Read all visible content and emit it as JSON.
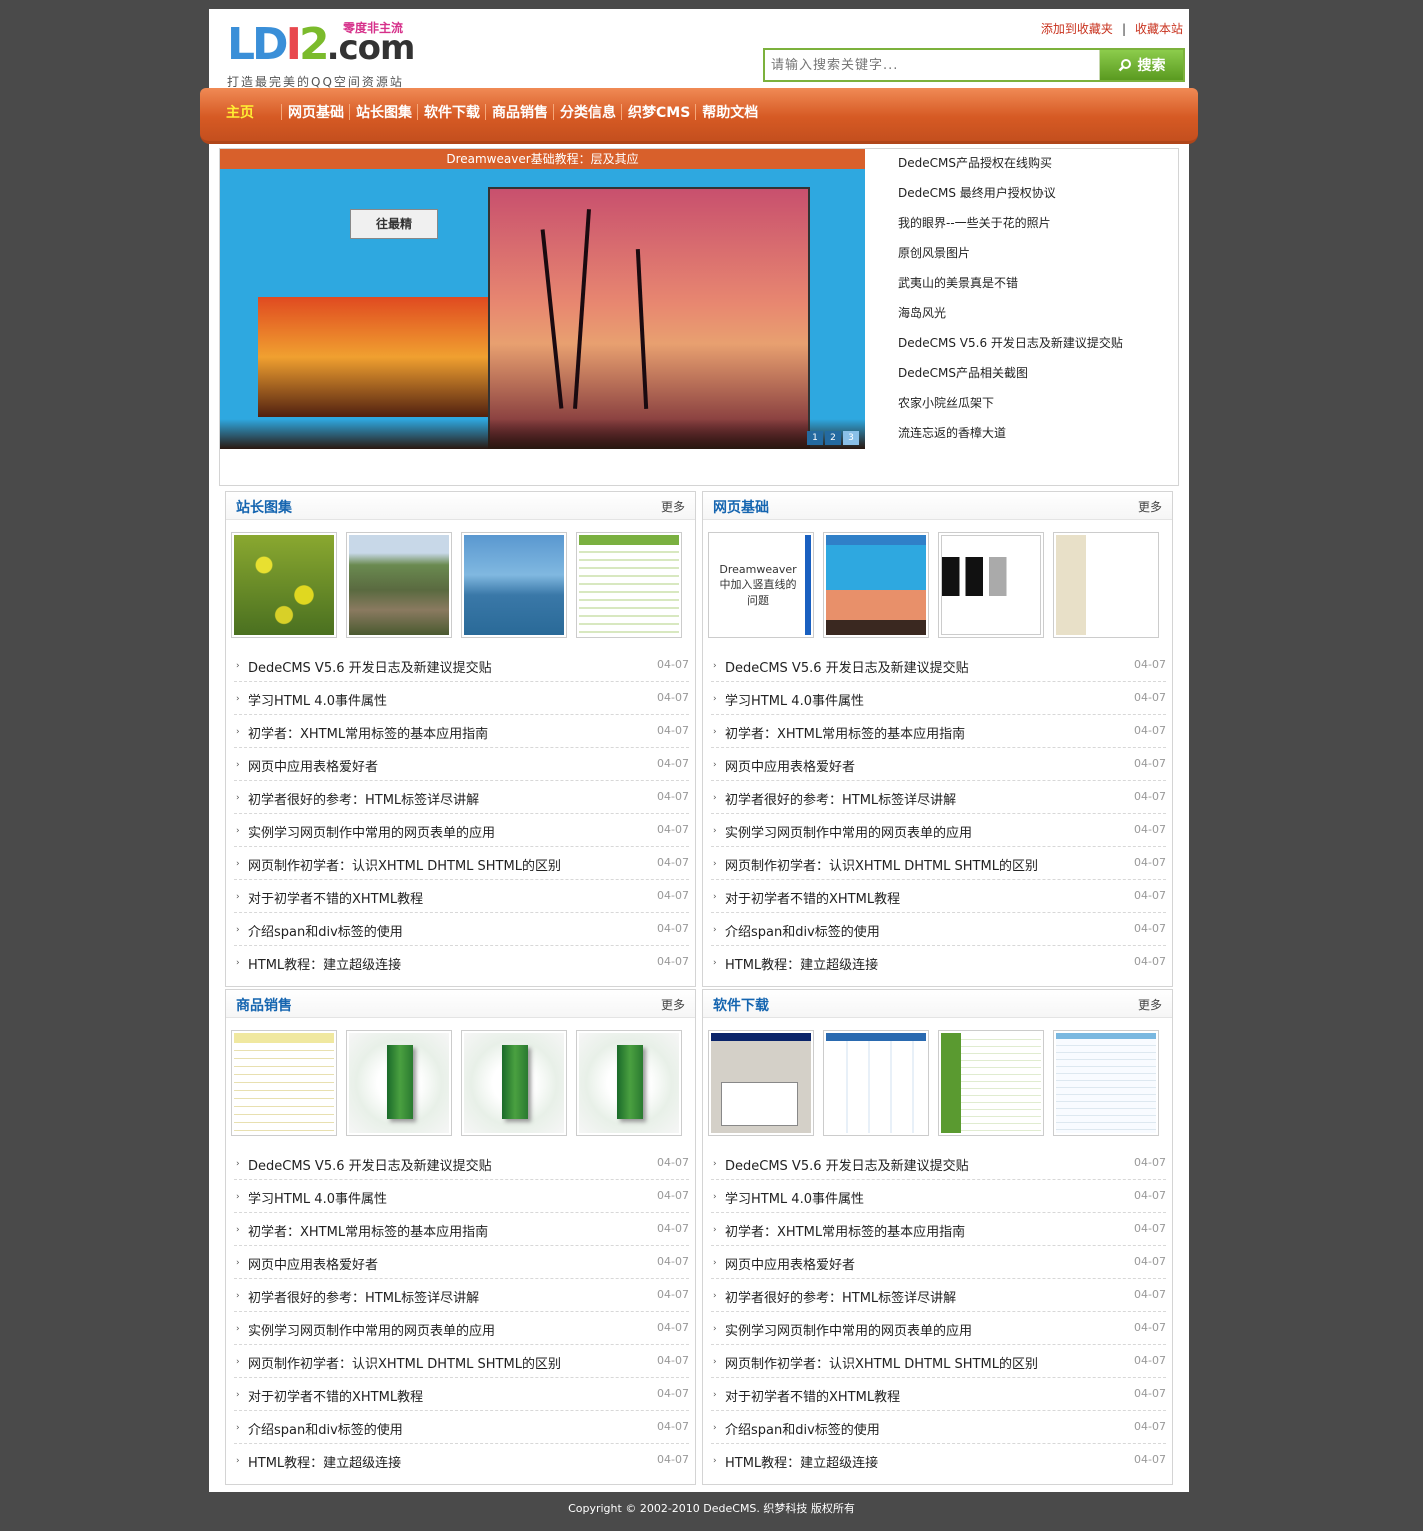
{
  "header": {
    "logo": {
      "part1": "LD",
      "part2": "I",
      "part3": "2",
      "part4": ".com",
      "tagline": "零度非主流",
      "slogan": "打造最完美的QQ空间资源站"
    },
    "links": {
      "add_fav": "添加到收藏夹",
      "separator": "|",
      "bookmark": "收藏本站"
    },
    "search": {
      "placeholder": "请输入搜索关键字...",
      "button": "搜索"
    }
  },
  "nav": {
    "items": [
      "主页",
      "网页基础",
      "站长图集",
      "软件下载",
      "商品销售",
      "分类信息",
      "织梦CMS",
      "帮助文档"
    ],
    "active": 0
  },
  "slideshow": {
    "caption": "Dreamweaver基础教程：层及其应",
    "image_label": "往最精",
    "pages": [
      "1",
      "2",
      "3"
    ],
    "active_page": 2
  },
  "top_list": [
    "DedeCMS产品授权在线购买",
    "DedeCMS 最终用户授权协议",
    "我的眼界--一些关于花的照片",
    "原创风景图片",
    "武夷山的美景真是不错",
    "海岛风光",
    "DedeCMS V5.6 开发日志及新建议提交贴",
    "DedeCMS产品相关截图",
    "农家小院丝瓜架下",
    "流连忘返的香樟大道"
  ],
  "sections": [
    {
      "title": "站长图集",
      "more": "更多",
      "thumbs": [
        "flower",
        "cliff",
        "sea",
        "web1"
      ]
    },
    {
      "title": "网页基础",
      "more": "更多",
      "thumbs": [
        "dw",
        "dwshot",
        "blocks",
        "cssbook"
      ],
      "dw_text": "Dreamweaver中加入竖直线的问题"
    },
    {
      "title": "商品销售",
      "more": "更多",
      "thumbs": [
        "table",
        "box3d",
        "box3d",
        "box3d"
      ]
    },
    {
      "title": "软件下载",
      "more": "更多",
      "thumbs": [
        "win",
        "portal",
        "green",
        "light"
      ]
    }
  ],
  "articles": [
    {
      "title": "DedeCMS V5.6 开发日志及新建议提交贴",
      "date": "04-07"
    },
    {
      "title": "学习HTML 4.0事件属性",
      "date": "04-07"
    },
    {
      "title": "初学者：XHTML常用标签的基本应用指南",
      "date": "04-07"
    },
    {
      "title": "网页中应用表格爱好者",
      "date": "04-07"
    },
    {
      "title": "初学者很好的参考：HTML标签详尽讲解",
      "date": "04-07"
    },
    {
      "title": "实例学习网页制作中常用的网页表单的应用",
      "date": "04-07"
    },
    {
      "title": "网页制作初学者：认识XHTML DHTML SHTML的区别",
      "date": "04-07"
    },
    {
      "title": "对于初学者不错的XHTML教程",
      "date": "04-07"
    },
    {
      "title": "介绍span和div标签的使用",
      "date": "04-07"
    },
    {
      "title": "HTML教程：建立超级连接",
      "date": "04-07"
    }
  ],
  "footer": {
    "copyright": "Copyright © 2002-2010 DedeCMS. 织梦科技 版权所有"
  }
}
